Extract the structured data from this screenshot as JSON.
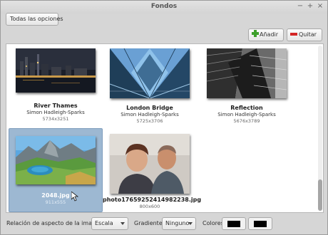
{
  "window": {
    "title": "Fondos"
  },
  "toolbar": {
    "all_options": "Todas las opciones",
    "add": "Añadir",
    "remove": "Quitar"
  },
  "items": [
    {
      "name": "River Thames",
      "author": "Simon Hadleigh-Sparks",
      "size": "5734x3251",
      "selected": false
    },
    {
      "name": "London Bridge",
      "author": "Simon Hadleigh-Sparks",
      "size": "5725x3706",
      "selected": false
    },
    {
      "name": "Reflection",
      "author": "Simon Hadleigh-Sparks",
      "size": "5676x3789",
      "selected": false
    },
    {
      "name": "2048.jpg",
      "author": "",
      "size": "911x555",
      "selected": true
    },
    {
      "name": "photo17659252414982238.jpg",
      "author": "",
      "size": "800x600",
      "selected": false
    }
  ],
  "bottom": {
    "aspect_label": "Relación de aspecto de la imagen",
    "aspect_value": "Escala",
    "gradient_label": "Gradiente",
    "gradient_value": "Ninguno",
    "colors_label": "Colores",
    "color1": "#000000",
    "color2": "#000000"
  },
  "colors": {
    "selection": "#9db8d2",
    "add_icon": "#3ea02c",
    "remove_icon": "#d32525"
  }
}
